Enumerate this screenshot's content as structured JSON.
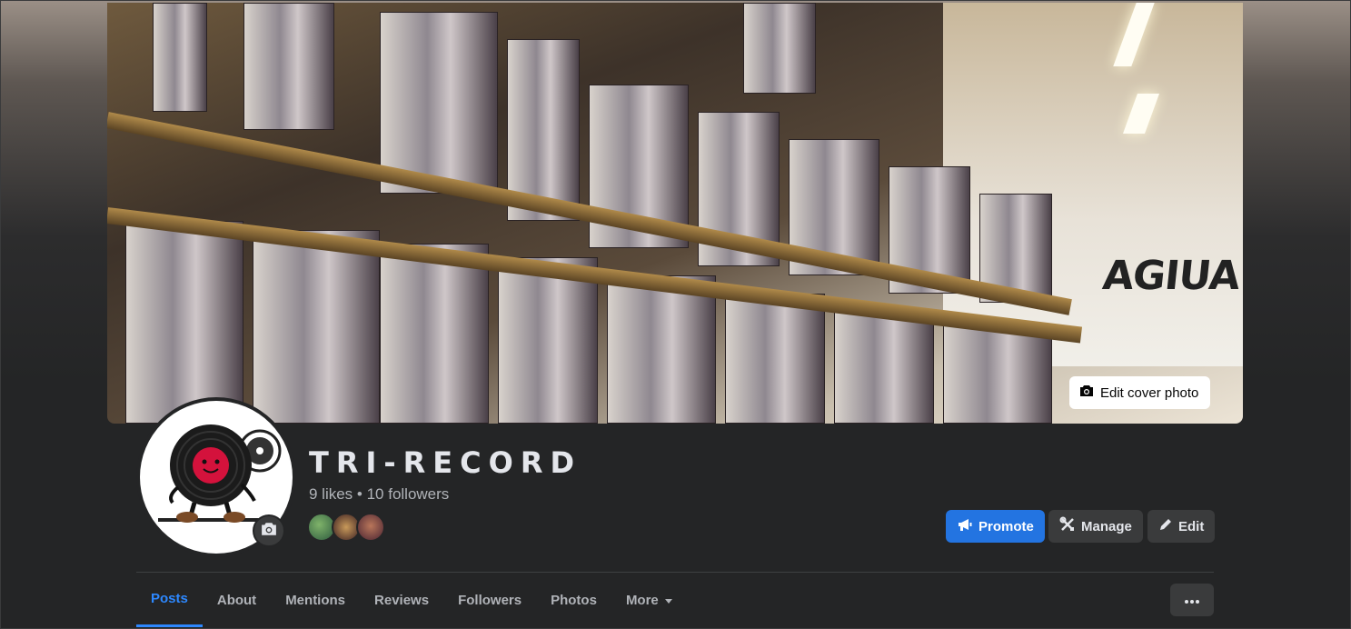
{
  "cover": {
    "edit_label": "Edit cover photo",
    "sign_text": "AGIUA"
  },
  "profile": {
    "name": "TRI-RECORD",
    "stats": "9 likes • 10 followers"
  },
  "actions": {
    "promote": "Promote",
    "manage": "Manage",
    "edit": "Edit"
  },
  "tabs": [
    {
      "label": "Posts",
      "active": true
    },
    {
      "label": "About"
    },
    {
      "label": "Mentions"
    },
    {
      "label": "Reviews"
    },
    {
      "label": "Followers"
    },
    {
      "label": "Photos"
    },
    {
      "label": "More"
    }
  ],
  "colors": {
    "accent": "#2374e1",
    "active_tab": "#2d88ff",
    "background": "#242526",
    "secondary_button": "#3a3b3c"
  },
  "icons": {
    "edit_cover": "camera-icon",
    "avatar_edit": "camera-icon",
    "promote": "megaphone-icon",
    "manage": "tools-icon",
    "edit": "pencil-icon",
    "more_tab": "caret-down-icon",
    "overflow": "ellipsis-icon"
  }
}
